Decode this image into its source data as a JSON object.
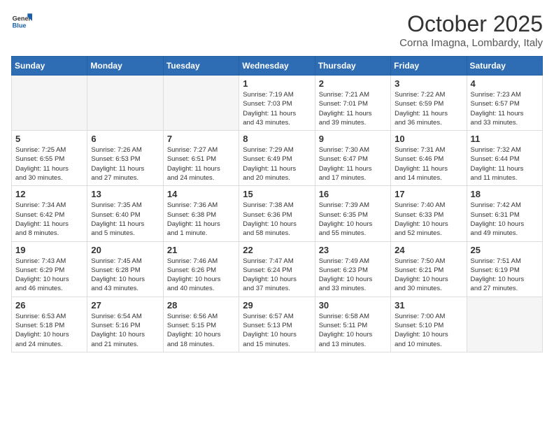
{
  "logo": {
    "general": "General",
    "blue": "Blue"
  },
  "title": "October 2025",
  "subtitle": "Corna Imagna, Lombardy, Italy",
  "days_header": [
    "Sunday",
    "Monday",
    "Tuesday",
    "Wednesday",
    "Thursday",
    "Friday",
    "Saturday"
  ],
  "weeks": [
    [
      {
        "day": "",
        "info": ""
      },
      {
        "day": "",
        "info": ""
      },
      {
        "day": "",
        "info": ""
      },
      {
        "day": "1",
        "info": "Sunrise: 7:19 AM\nSunset: 7:03 PM\nDaylight: 11 hours\nand 43 minutes."
      },
      {
        "day": "2",
        "info": "Sunrise: 7:21 AM\nSunset: 7:01 PM\nDaylight: 11 hours\nand 39 minutes."
      },
      {
        "day": "3",
        "info": "Sunrise: 7:22 AM\nSunset: 6:59 PM\nDaylight: 11 hours\nand 36 minutes."
      },
      {
        "day": "4",
        "info": "Sunrise: 7:23 AM\nSunset: 6:57 PM\nDaylight: 11 hours\nand 33 minutes."
      }
    ],
    [
      {
        "day": "5",
        "info": "Sunrise: 7:25 AM\nSunset: 6:55 PM\nDaylight: 11 hours\nand 30 minutes."
      },
      {
        "day": "6",
        "info": "Sunrise: 7:26 AM\nSunset: 6:53 PM\nDaylight: 11 hours\nand 27 minutes."
      },
      {
        "day": "7",
        "info": "Sunrise: 7:27 AM\nSunset: 6:51 PM\nDaylight: 11 hours\nand 24 minutes."
      },
      {
        "day": "8",
        "info": "Sunrise: 7:29 AM\nSunset: 6:49 PM\nDaylight: 11 hours\nand 20 minutes."
      },
      {
        "day": "9",
        "info": "Sunrise: 7:30 AM\nSunset: 6:47 PM\nDaylight: 11 hours\nand 17 minutes."
      },
      {
        "day": "10",
        "info": "Sunrise: 7:31 AM\nSunset: 6:46 PM\nDaylight: 11 hours\nand 14 minutes."
      },
      {
        "day": "11",
        "info": "Sunrise: 7:32 AM\nSunset: 6:44 PM\nDaylight: 11 hours\nand 11 minutes."
      }
    ],
    [
      {
        "day": "12",
        "info": "Sunrise: 7:34 AM\nSunset: 6:42 PM\nDaylight: 11 hours\nand 8 minutes."
      },
      {
        "day": "13",
        "info": "Sunrise: 7:35 AM\nSunset: 6:40 PM\nDaylight: 11 hours\nand 5 minutes."
      },
      {
        "day": "14",
        "info": "Sunrise: 7:36 AM\nSunset: 6:38 PM\nDaylight: 11 hours\nand 1 minute."
      },
      {
        "day": "15",
        "info": "Sunrise: 7:38 AM\nSunset: 6:36 PM\nDaylight: 10 hours\nand 58 minutes."
      },
      {
        "day": "16",
        "info": "Sunrise: 7:39 AM\nSunset: 6:35 PM\nDaylight: 10 hours\nand 55 minutes."
      },
      {
        "day": "17",
        "info": "Sunrise: 7:40 AM\nSunset: 6:33 PM\nDaylight: 10 hours\nand 52 minutes."
      },
      {
        "day": "18",
        "info": "Sunrise: 7:42 AM\nSunset: 6:31 PM\nDaylight: 10 hours\nand 49 minutes."
      }
    ],
    [
      {
        "day": "19",
        "info": "Sunrise: 7:43 AM\nSunset: 6:29 PM\nDaylight: 10 hours\nand 46 minutes."
      },
      {
        "day": "20",
        "info": "Sunrise: 7:45 AM\nSunset: 6:28 PM\nDaylight: 10 hours\nand 43 minutes."
      },
      {
        "day": "21",
        "info": "Sunrise: 7:46 AM\nSunset: 6:26 PM\nDaylight: 10 hours\nand 40 minutes."
      },
      {
        "day": "22",
        "info": "Sunrise: 7:47 AM\nSunset: 6:24 PM\nDaylight: 10 hours\nand 37 minutes."
      },
      {
        "day": "23",
        "info": "Sunrise: 7:49 AM\nSunset: 6:23 PM\nDaylight: 10 hours\nand 33 minutes."
      },
      {
        "day": "24",
        "info": "Sunrise: 7:50 AM\nSunset: 6:21 PM\nDaylight: 10 hours\nand 30 minutes."
      },
      {
        "day": "25",
        "info": "Sunrise: 7:51 AM\nSunset: 6:19 PM\nDaylight: 10 hours\nand 27 minutes."
      }
    ],
    [
      {
        "day": "26",
        "info": "Sunrise: 6:53 AM\nSunset: 5:18 PM\nDaylight: 10 hours\nand 24 minutes."
      },
      {
        "day": "27",
        "info": "Sunrise: 6:54 AM\nSunset: 5:16 PM\nDaylight: 10 hours\nand 21 minutes."
      },
      {
        "day": "28",
        "info": "Sunrise: 6:56 AM\nSunset: 5:15 PM\nDaylight: 10 hours\nand 18 minutes."
      },
      {
        "day": "29",
        "info": "Sunrise: 6:57 AM\nSunset: 5:13 PM\nDaylight: 10 hours\nand 15 minutes."
      },
      {
        "day": "30",
        "info": "Sunrise: 6:58 AM\nSunset: 5:11 PM\nDaylight: 10 hours\nand 13 minutes."
      },
      {
        "day": "31",
        "info": "Sunrise: 7:00 AM\nSunset: 5:10 PM\nDaylight: 10 hours\nand 10 minutes."
      },
      {
        "day": "",
        "info": ""
      }
    ]
  ]
}
